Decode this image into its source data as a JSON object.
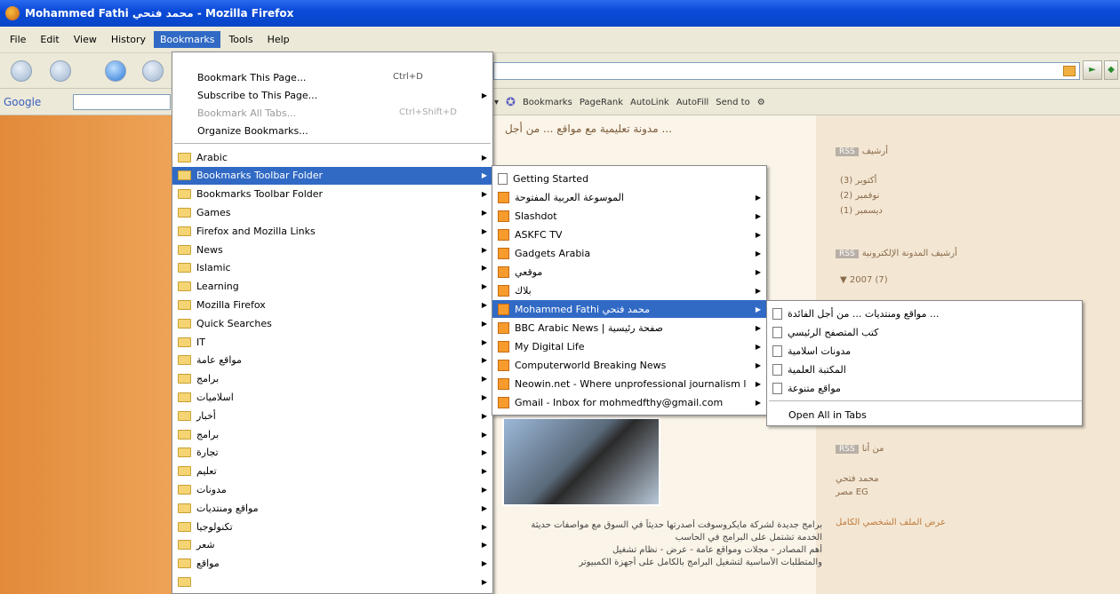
{
  "window": {
    "title": "Mohammed Fathi محمد فتحي - Mozilla Firefox"
  },
  "menubar": {
    "items": [
      "File",
      "Edit",
      "View",
      "History",
      "Bookmarks",
      "Tools",
      "Help"
    ]
  },
  "googlebar": {
    "logo": "Google"
  },
  "toolbar2": {
    "bookmarks_label": "Bookmarks",
    "pagerank": "PageRank",
    "autolink": "AutoLink",
    "autofill": "AutoFill",
    "sendto": "Send to"
  },
  "bookmarks_menu": {
    "top_items": [
      {
        "label": "Bookmark This Page...",
        "shortcut": "Ctrl+D"
      },
      {
        "label": "Subscribe to This Page...",
        "shortcut": ""
      },
      {
        "label": "Bookmark All Tabs...",
        "shortcut": "Ctrl+Shift+D",
        "disabled": true
      },
      {
        "label": "Organize Bookmarks...",
        "shortcut": ""
      }
    ],
    "folders": [
      "Arabic",
      "Bookmarks Toolbar Folder",
      "Bookmarks Toolbar Folder",
      "Games",
      "Firefox and Mozilla Links",
      "News",
      "Islamic",
      "Learning",
      "Mozilla Firefox",
      "Quick Searches",
      "IT",
      "مواقع عامة",
      "برامج",
      "اسلاميات",
      "أخبار",
      "برامج",
      "تجارة",
      "تعليم",
      "مدونات",
      "مواقع ومنتديات",
      "تكنولوجيا",
      "شعر",
      "مواقع",
      ""
    ]
  },
  "toolbar_submenu": {
    "items": [
      {
        "label": "Getting Started",
        "type": "page"
      },
      {
        "label": "الموسوعة العربية المفتوحة",
        "type": "rss"
      },
      {
        "label": "Slashdot",
        "type": "rss"
      },
      {
        "label": "ASKFC TV",
        "type": "rss"
      },
      {
        "label": "Gadgets Arabia",
        "type": "rss"
      },
      {
        "label": "موقعي",
        "type": "rss"
      },
      {
        "label": "بلاك",
        "type": "rss"
      },
      {
        "label": "Mohammed Fathi محمد فتحي",
        "type": "rss"
      },
      {
        "label": "BBC Arabic News | صفحة رئيسية",
        "type": "rss"
      },
      {
        "label": "My Digital Life",
        "type": "rss"
      },
      {
        "label": "Computerworld Breaking News",
        "type": "rss"
      },
      {
        "label": "Neowin.net - Where unprofessional journalism looks better",
        "type": "rss"
      },
      {
        "label": "Gmail - Inbox for mohmedfthy@gmail.com",
        "type": "rss"
      }
    ]
  },
  "feed_submenu": {
    "items": [
      "مواقع ومنتديات ... من أجل الفائدة ...",
      "كتب المتصفح الرئيسي",
      "مدونات اسلامية",
      "المكتبة العلمية",
      "مواقع متنوعة"
    ],
    "open_all": "Open All in Tabs"
  },
  "page": {
    "title": "مدونة تعليمية مع مواقع ... من أجل ...",
    "sidebar": {
      "section1": "أرشيف",
      "links1": [
        "أكتوبر (3)",
        "نوفمبر (2)",
        "ديسمبر (1)"
      ],
      "section2": "أرشيف المدونة الإلكترونية",
      "year": "2007 (7)",
      "section3": "من أنا",
      "name": "محمد فتحي",
      "country": "مصر EG",
      "profile": "عرض الملف الشخصي الكامل"
    },
    "text": [
      "برامج جديدة لشركة مايكروسوفت أصدرتها حديثاً في السوق مع مواصفات حديثة",
      "الخدمة تشتمل على البرامج في الحاسب",
      "أهم المصادر - مجلات ومواقع عامة - عرض - نظام تشغيل",
      "والمتطلبات الأساسية لتشغيل البرامج بالكامل على أجهزة الكمبيوتر"
    ]
  }
}
